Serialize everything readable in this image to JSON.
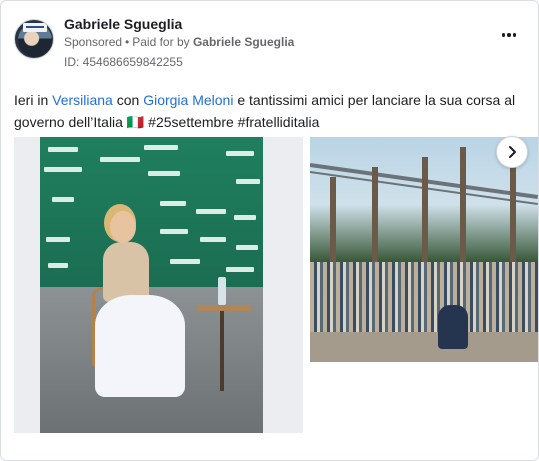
{
  "post": {
    "page_name": "Gabriele Sgueglia",
    "sponsored_label": "Sponsored",
    "paid_for_prefix": "Paid for by",
    "paid_for_name": "Gabriele Sgueglia",
    "ad_id": "ID: 454686659842255",
    "text": {
      "part1": "Ieri in ",
      "link1": "Versiliana",
      "part2": " con ",
      "link2": "Giorgia Meloni",
      "part3": " e tantissimi amici per lanciare la sua corsa al governo dell’Italia 🇮🇹 #25settembre #fratelliditalia"
    }
  },
  "icons": {
    "more": "more-horizontal-icon",
    "next": "chevron-right-icon"
  },
  "colors": {
    "link": "#216fdb",
    "meta": "#65676b",
    "text": "#1c1e21"
  }
}
